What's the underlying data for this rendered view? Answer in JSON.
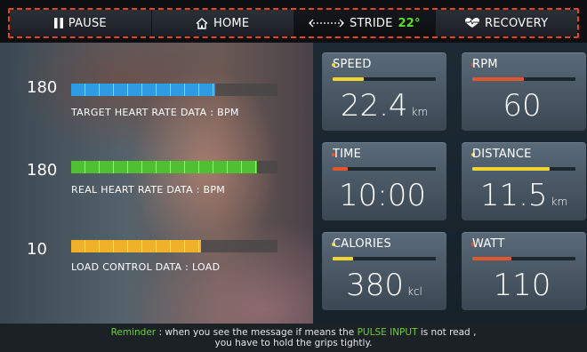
{
  "nav": {
    "pause": "PAUSE",
    "home": "HOME",
    "stride_label": "STRIDE",
    "stride_value": "22°",
    "recovery": "RECOVERY"
  },
  "heart_rate": {
    "target": {
      "value": "180",
      "label": "TARGET HEART RATE DATA : BPM",
      "fill_fraction": 0.7,
      "color": "#2e9be2"
    },
    "real": {
      "value": "180",
      "label": "REAL HEART RATE DATA : BPM",
      "fill_fraction": 0.9,
      "color": "#4fc02f"
    },
    "load": {
      "value": "10",
      "label": "LOAD CONTROL DATA : LOAD",
      "fill_fraction": 0.63,
      "color": "#f0b12a"
    }
  },
  "tiles": {
    "speed": {
      "label": "SPEED",
      "value": "22.4",
      "unit": "km",
      "dot": "#f0d531",
      "bar": "#f0d531",
      "fill_fraction": 0.3
    },
    "rpm": {
      "label": "RPM",
      "value": "60",
      "unit": "",
      "dot": "#e2562c",
      "bar": "#e2562c",
      "fill_fraction": 0.5
    },
    "time": {
      "label": "TIME",
      "value": "10:00",
      "unit": "",
      "dot": "#e2562c",
      "bar": "#e2562c",
      "fill_fraction": 0.15
    },
    "distance": {
      "label": "DISTANCE",
      "value": "11.5",
      "unit": "km",
      "dot": "#f0d531",
      "bar": "#f0d531",
      "fill_fraction": 0.75
    },
    "calories": {
      "label": "CALORIES",
      "value": "380",
      "unit": "kcl",
      "dot": "#f0d531",
      "bar": "#f0d531",
      "fill_fraction": 0.2
    },
    "watt": {
      "label": "WATT",
      "value": "110",
      "unit": "",
      "dot": "#e2562c",
      "bar": "#e2562c",
      "fill_fraction": 0.38
    }
  },
  "reminder": {
    "prefix": "Reminder",
    "part1": " : when you see the message if means the ",
    "highlight": "PULSE INPUT",
    "part2": " is not read ,",
    "line2": "you have to hold the grips tightly."
  }
}
